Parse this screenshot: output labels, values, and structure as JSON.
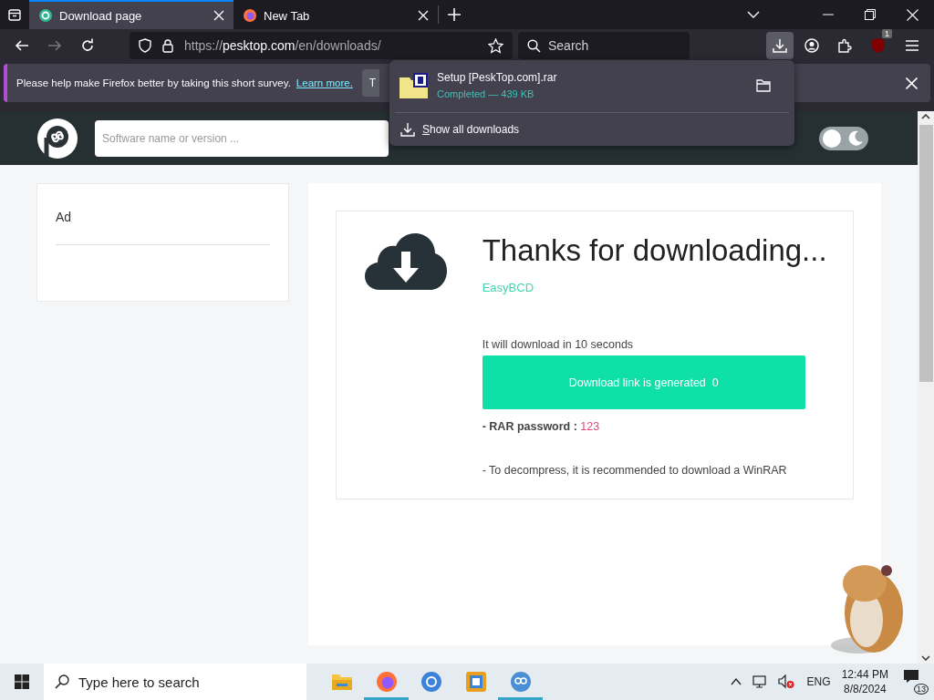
{
  "browser": {
    "tabs": [
      {
        "title": "Download page",
        "kind": "site",
        "selected": true
      },
      {
        "title": "New Tab",
        "kind": "firefox",
        "selected": false
      }
    ],
    "url": {
      "scheme": "https://",
      "host": "pesktop.com",
      "path": "/en/downloads/"
    },
    "search_placeholder": "Search",
    "extension_badge": "1"
  },
  "notification": {
    "message": "Please help make Firefox better by taking this short survey.",
    "link": "Learn more.",
    "button": "T"
  },
  "downloads_panel": {
    "items": [
      {
        "name": "Setup [PeskTop.com].rar",
        "status": "Completed — 439 KB"
      }
    ],
    "show_all": "Show all downloads"
  },
  "site": {
    "search_placeholder": "Software name or version ...",
    "dark_mode": false
  },
  "sidebar": {
    "ad_label": "Ad"
  },
  "main": {
    "title": "Thanks for downloading...",
    "software": "EasyBCD",
    "countdown": "It will download in 10 seconds",
    "button": "Download link is generated  0",
    "password_label": "- RAR password :",
    "password": "123",
    "note": "- To decompress, it is recommended to download a WinRAR"
  },
  "taskbar": {
    "search_placeholder": "Type here to search",
    "apps": [
      {
        "kind": "explorer",
        "running": false
      },
      {
        "kind": "firefox",
        "running": true
      },
      {
        "kind": "chrome",
        "running": false
      },
      {
        "kind": "app",
        "running": false
      },
      {
        "kind": "qbittorrent",
        "running": true
      }
    ],
    "language": "ENG",
    "time": "12:44 PM",
    "date": "8/8/2024",
    "notification_count": "13"
  }
}
